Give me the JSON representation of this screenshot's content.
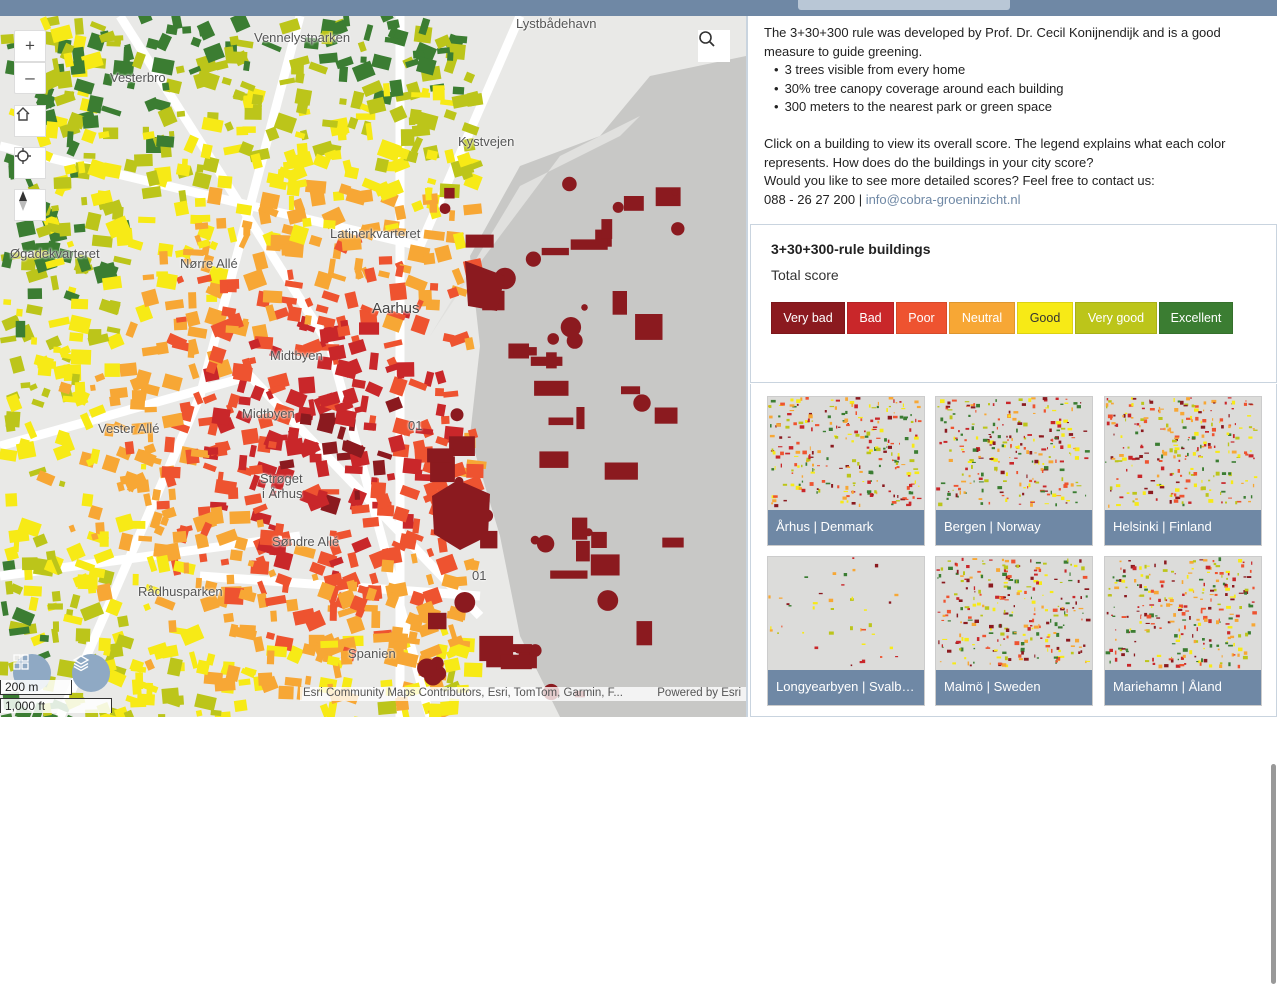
{
  "header": {
    "tab_label": ""
  },
  "map": {
    "zoom_in": "+",
    "zoom_out": "–",
    "labels": [
      {
        "text": "Lystbådehavn",
        "cls": ""
      },
      {
        "text": "Vennelystparken",
        "cls": ""
      },
      {
        "text": "Vesterbro",
        "cls": ""
      },
      {
        "text": "Latinerkvarteret",
        "cls": ""
      },
      {
        "text": "Aarhus",
        "cls": "big"
      },
      {
        "text": "Øgadekvarteret",
        "cls": ""
      },
      {
        "text": "Midtbyen",
        "cls": ""
      },
      {
        "text": "Midtbyen",
        "cls": ""
      },
      {
        "text": "Strøget",
        "cls": ""
      },
      {
        "text": "i Århus",
        "cls": ""
      },
      {
        "text": "Rådhusparken",
        "cls": ""
      },
      {
        "text": "Vester Allé",
        "cls": ""
      },
      {
        "text": "Kystvejen",
        "cls": ""
      },
      {
        "text": "Nørre Allé",
        "cls": ""
      },
      {
        "text": "Spanien",
        "cls": ""
      },
      {
        "text": "Søndre Allé",
        "cls": ""
      },
      {
        "text": "01",
        "cls": ""
      },
      {
        "text": "01",
        "cls": ""
      }
    ],
    "scale_m": "200 m",
    "scale_ft": "1,000 ft",
    "attribution": "Esri Community Maps Contributors, Esri, TomTom, Garmin, F...",
    "powered_by": "Powered by Esri"
  },
  "description": {
    "intro": "The 3+30+300 rule was developed by Prof. Dr. Cecil Konijnendijk and is a good measure to guide greening.",
    "bullets": [
      "3 trees visible from every home",
      "30% tree canopy coverage around each building",
      "300 meters to the nearest park or green space"
    ],
    "para2": "Click on a building to view its overall score. The legend explains what each color represents. How does do the buildings in your city score?",
    "para3": "Would you like to see more detailed scores? Feel free to contact us:",
    "phone": "088 - 26 27 200 | ",
    "email": "info@cobra-groeninzicht.nl"
  },
  "legend": {
    "title": "3+30+300-rule buildings",
    "subtitle": "Total score",
    "items": [
      {
        "label": "Very bad",
        "color": "#8b1a1f",
        "text": "#ffffff"
      },
      {
        "label": "Bad",
        "color": "#c9272a",
        "text": "#ffffff"
      },
      {
        "label": "Poor",
        "color": "#ee5330",
        "text": "#ffffff"
      },
      {
        "label": "Neutral",
        "color": "#f7a735",
        "text": "#ffffff"
      },
      {
        "label": "Good",
        "color": "#f7ea16",
        "text": "#333333"
      },
      {
        "label": "Very good",
        "color": "#bcc51a",
        "text": "#ffffff"
      },
      {
        "label": "Excellent",
        "color": "#3b7d32",
        "text": "#ffffff"
      }
    ]
  },
  "gallery": {
    "cards": [
      {
        "label": "Århus | Denmark"
      },
      {
        "label": "Bergen | Norway"
      },
      {
        "label": "Helsinki | Finland"
      },
      {
        "label": "Longyearbyen | Svalbard"
      },
      {
        "label": "Malmö | Sweden"
      },
      {
        "label": "Mariehamn | Åland"
      }
    ]
  }
}
